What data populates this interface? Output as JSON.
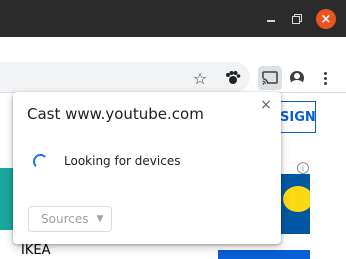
{
  "window": {
    "minimize_glyph": "",
    "close_glyph": "×"
  },
  "toolbar": {
    "star_glyph": "☆",
    "extension_glyph": "✿"
  },
  "page": {
    "signin_label": "SIGN IN",
    "ad_info_glyph": "i",
    "ad_label": "IKEA"
  },
  "dialog": {
    "title": "Cast www.youtube.com",
    "close_glyph": "×",
    "status": "Looking for devices",
    "sources_label": "Sources",
    "sources_caret": "▼"
  },
  "colors": {
    "accent": "#1a73e8",
    "titlebar": "#2b2b2b",
    "close_button": "#e95420",
    "youtube_blue": "#065fd4"
  }
}
